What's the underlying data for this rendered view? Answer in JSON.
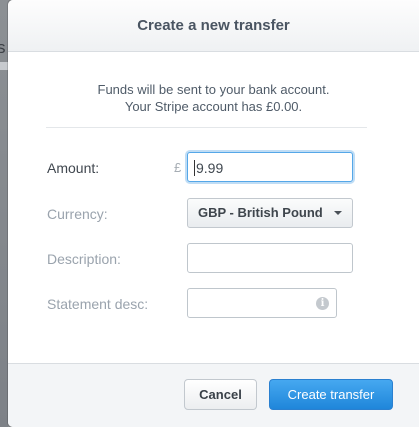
{
  "backdrop": {
    "text_fragment": "s"
  },
  "modal": {
    "title": "Create a new transfer",
    "info_line_1": "Funds will be sent to your bank account.",
    "info_line_2": "Your Stripe account has £0.00."
  },
  "form": {
    "amount": {
      "label": "Amount:",
      "currency_symbol": "£",
      "value": "9.99"
    },
    "currency": {
      "label": "Currency:",
      "selected": "GBP - British Pound"
    },
    "description": {
      "label": "Description:",
      "value": ""
    },
    "statement_desc": {
      "label": "Statement desc:",
      "value": ""
    }
  },
  "footer": {
    "cancel_label": "Cancel",
    "submit_label": "Create transfer"
  },
  "colors": {
    "primary_button": "#2a8ee0",
    "focus_ring": "#55a7e8",
    "overlay": "#8a8d91"
  },
  "icons": {
    "select_chevron": "chevron-down-icon",
    "statement_info": "info-icon"
  }
}
